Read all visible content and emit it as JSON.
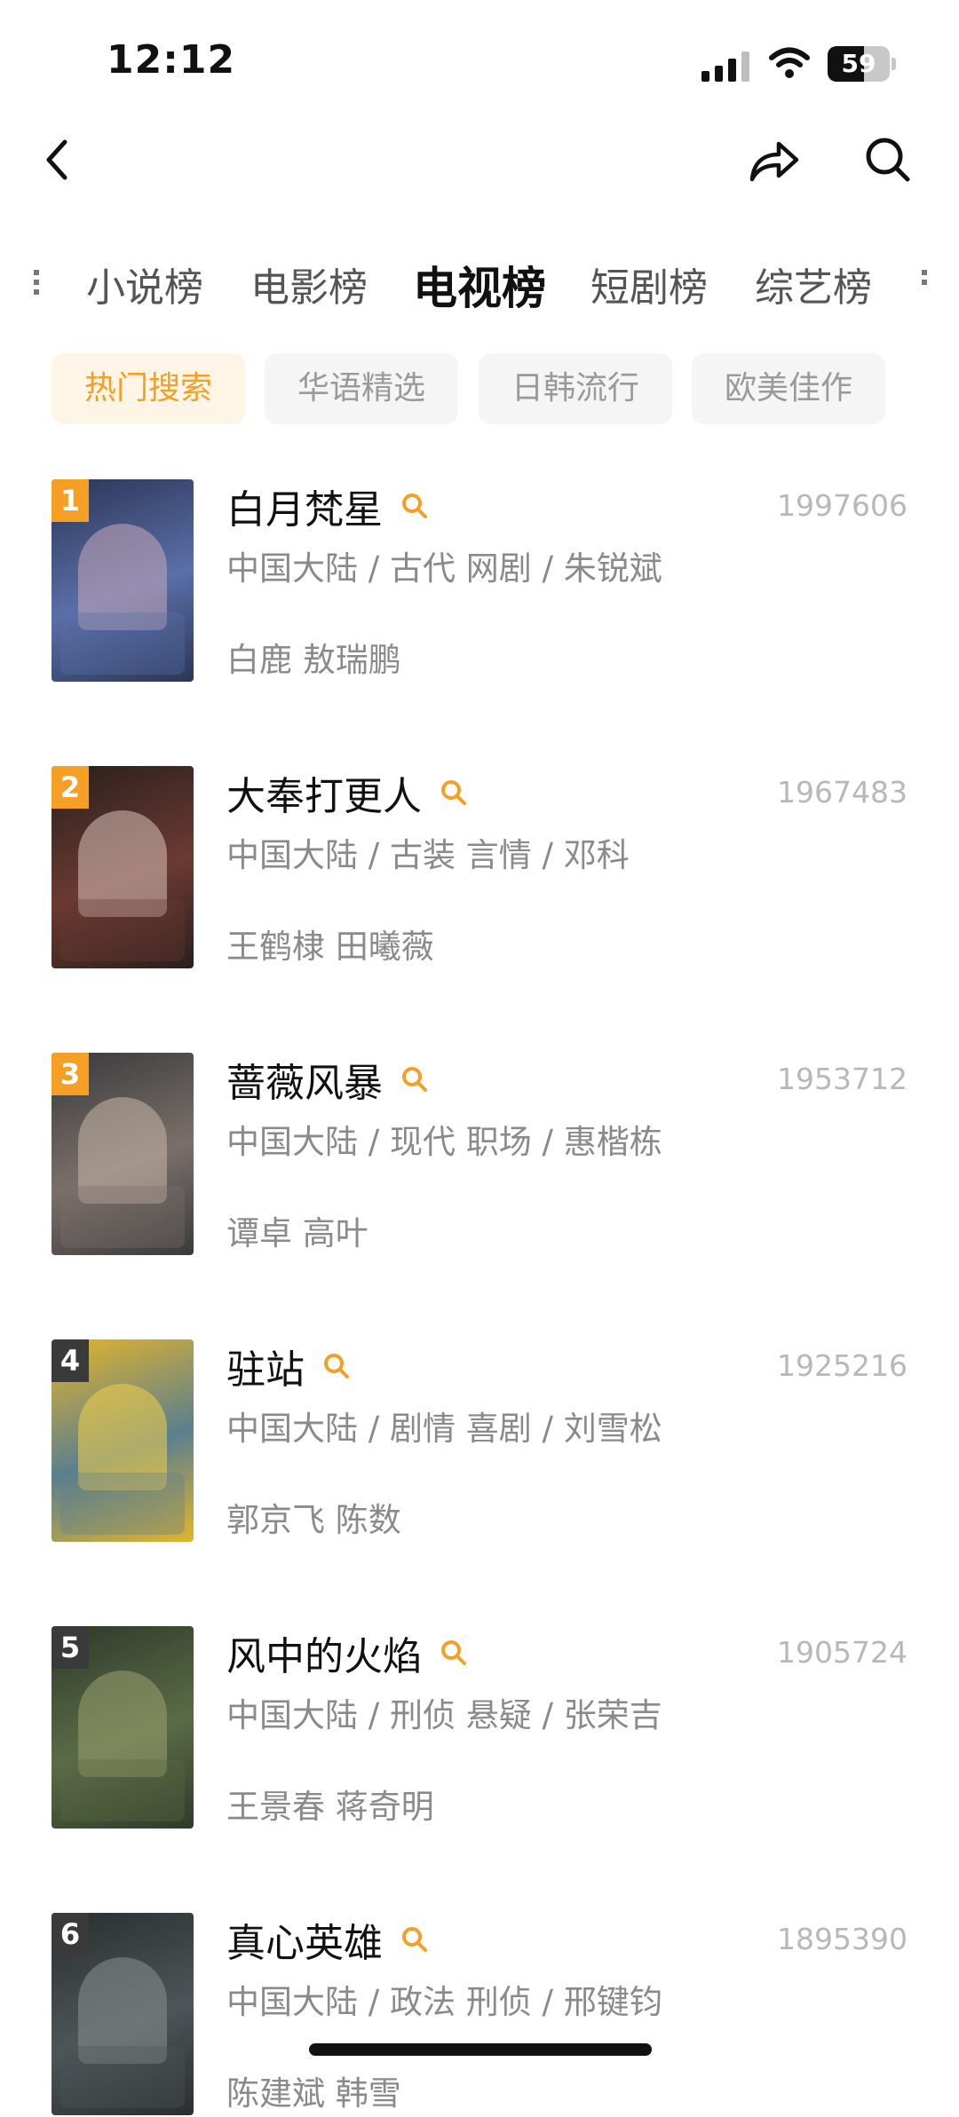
{
  "status_bar": {
    "time": "12:12",
    "battery": "59",
    "battery_level": 0.59
  },
  "category_tabs": [
    "小说榜",
    "电影榜",
    "电视榜",
    "短剧榜",
    "综艺榜"
  ],
  "active_category": "电视榜",
  "filter_chips": [
    "热门搜索",
    "华语精选",
    "日韩流行",
    "欧美佳作"
  ],
  "active_filter": "热门搜索",
  "items": [
    {
      "rank": "1",
      "title": "白月梵星",
      "hot": "1997606",
      "meta": "中国大陆 / 古代 网剧 / 朱锐斌",
      "cast": "白鹿 敖瑞鹏",
      "badge_color": "#f5a025",
      "poster_colors": [
        "#2b3556",
        "#5a6fa8",
        "#c9a9b9"
      ]
    },
    {
      "rank": "2",
      "title": "大奉打更人",
      "hot": "1967483",
      "meta": "中国大陆 / 古装 言情 / 邓科",
      "cast": "王鹤棣 田曦薇",
      "badge_color": "#f5a025",
      "poster_colors": [
        "#2a1f1c",
        "#6b3a32",
        "#d9c2b8"
      ]
    },
    {
      "rank": "3",
      "title": "蔷薇风暴",
      "hot": "1953712",
      "meta": "中国大陆 / 现代 职场 / 惠楷栋",
      "cast": "谭卓 高叶",
      "badge_color": "#f5a025",
      "poster_colors": [
        "#3a3a3c",
        "#7a6f6a",
        "#c8b7a8"
      ]
    },
    {
      "rank": "4",
      "title": "驻站",
      "hot": "1925216",
      "meta": "中国大陆 / 剧情 喜剧 / 刘雪松",
      "cast": "郭京飞 陈数",
      "badge_color": "#3a3a3a",
      "poster_colors": [
        "#e3b52a",
        "#5b7f8f",
        "#f2cf4d"
      ]
    },
    {
      "rank": "5",
      "title": "风中的火焰",
      "hot": "1905724",
      "meta": "中国大陆 / 刑侦 悬疑 / 张荣吉",
      "cast": "王景春 蒋奇明",
      "badge_color": "#3a3a3a",
      "poster_colors": [
        "#2f3a2a",
        "#5b6b46",
        "#9aa06f"
      ]
    },
    {
      "rank": "6",
      "title": "真心英雄",
      "hot": "1895390",
      "meta": "中国大陆 / 政法 刑侦 / 邢键钧",
      "cast": "陈建斌 韩雪",
      "badge_color": "#3a3a3a",
      "poster_colors": [
        "#2a2e30",
        "#4e5558",
        "#8a8f90"
      ]
    }
  ],
  "icons": {
    "back": "chevron-left-icon",
    "share": "share-icon",
    "search": "search-icon",
    "title_search": "search-icon"
  },
  "accent_color": "#f5a025"
}
